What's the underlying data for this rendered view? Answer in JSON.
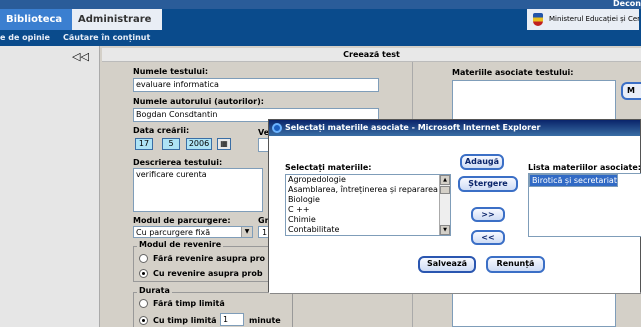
{
  "topbar": {
    "tab_active": "Biblioteca",
    "tab_admin": "Administrare",
    "corner_text": "Decon",
    "ministry": "Ministerul Educației și Cerc"
  },
  "subnav": {
    "item1": "e de opinie",
    "item2": "Căutare în conținut"
  },
  "sidebar": {
    "collapse_glyph": "◁◁"
  },
  "section_title": "Creează test",
  "form": {
    "name_label": "Numele testului:",
    "name_value": "evaluare informatica",
    "author_label": "Numele autorului (autorilor):",
    "author_value": "Bogdan Consdtantin",
    "date_label": "Data creării:",
    "date_day": "17",
    "date_month": "5",
    "date_year": "2006",
    "ver_label": "Ve",
    "desc_label": "Descrierea testului:",
    "desc_value": "verificare curenta",
    "mode_label": "Modul de parcurgere:",
    "mode_value": "Cu parcurgere fixă",
    "gr_label": "Gr",
    "gr_value": "1",
    "return_legend": "Modul de revenire",
    "return_opt1": "Fără revenire asupra pro",
    "return_opt2": "Cu revenire asupra prob",
    "duration_legend": "Durata",
    "duration_opt1": "Fără timp limită",
    "duration_opt2": "Cu timp limită",
    "duration_value": "1",
    "duration_unit": "minute"
  },
  "right": {
    "assoc_label": "Materiile asociate testului:",
    "edge_button": "M"
  },
  "dialog": {
    "title": "Selectați materiile asociate - Microsoft Internet Explorer",
    "select_label": "Selectați materiile:",
    "subjects": [
      "Agropedologie",
      "Asamblarea, întreținerea și repararea",
      "Biologie",
      "C ++",
      "Chimie",
      "Contabilitate"
    ],
    "list_label": "Lista materiilor asociate:",
    "selected_subjects": [
      "Birotică și secretariat"
    ],
    "add_button": "Adaugă",
    "delete_button": "Ștergere",
    "move_right": ">>",
    "move_left": "<<",
    "save_button": "Salvează",
    "cancel_button": "Renunță"
  },
  "colors": {
    "topbar": "#0a4b8c",
    "active_tab": "#3b7fd0",
    "selection": "#316ac5",
    "button_border": "#3b6fc6"
  }
}
